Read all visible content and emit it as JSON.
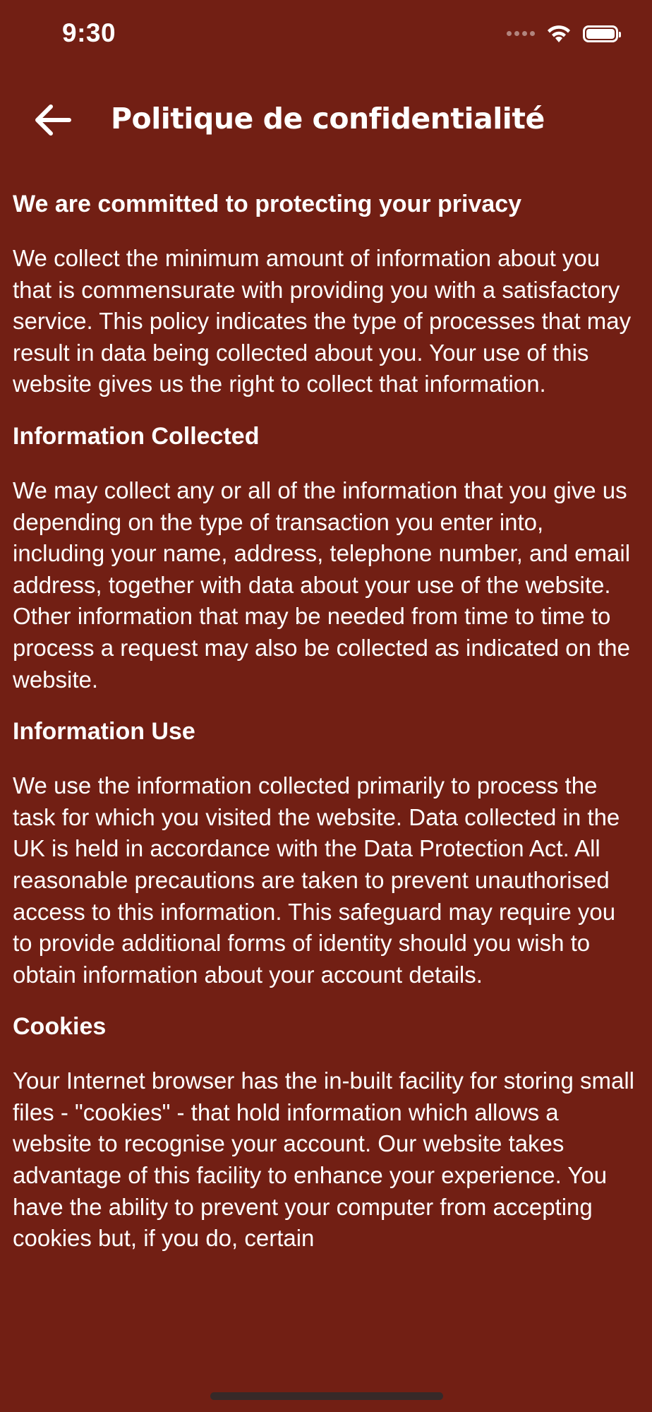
{
  "status_bar": {
    "time": "9:30"
  },
  "nav": {
    "title": "Politique de confidentialité",
    "back_icon": "arrow-left-icon"
  },
  "sections": [
    {
      "heading": "We are committed to protecting your privacy",
      "body": "We collect the minimum amount of information about you that is commensurate with providing you with a satisfactory service. This policy indicates the type of processes that may result in data being collected about you. Your use of this website gives us the right to collect that information."
    },
    {
      "heading": "Information Collected",
      "body": "We may collect any or all of the information that you give us depending on the type of transaction you enter into, including your name, address, telephone number, and email address, together with data about your use of the website. Other information that may be needed from time to time to process a request may also be collected as indicated on the website."
    },
    {
      "heading": "Information Use",
      "body": "We use the information collected primarily to process the task for which you visited the website. Data collected in the UK is held in accordance with the Data Protection Act. All reasonable precautions are taken to prevent unauthorised access to this information. This safeguard may require you to provide additional forms of identity should you wish to obtain information about your account details."
    },
    {
      "heading": "Cookies",
      "body": "Your Internet browser has the in-built facility for storing small files - \"cookies\" - that hold information which allows a website to recognise your account. Our website takes advantage of this facility to enhance your experience. You have the ability to prevent your computer from accepting cookies but, if you do, certain"
    }
  ],
  "colors": {
    "background": "#721f14",
    "text": "#ffffff"
  }
}
